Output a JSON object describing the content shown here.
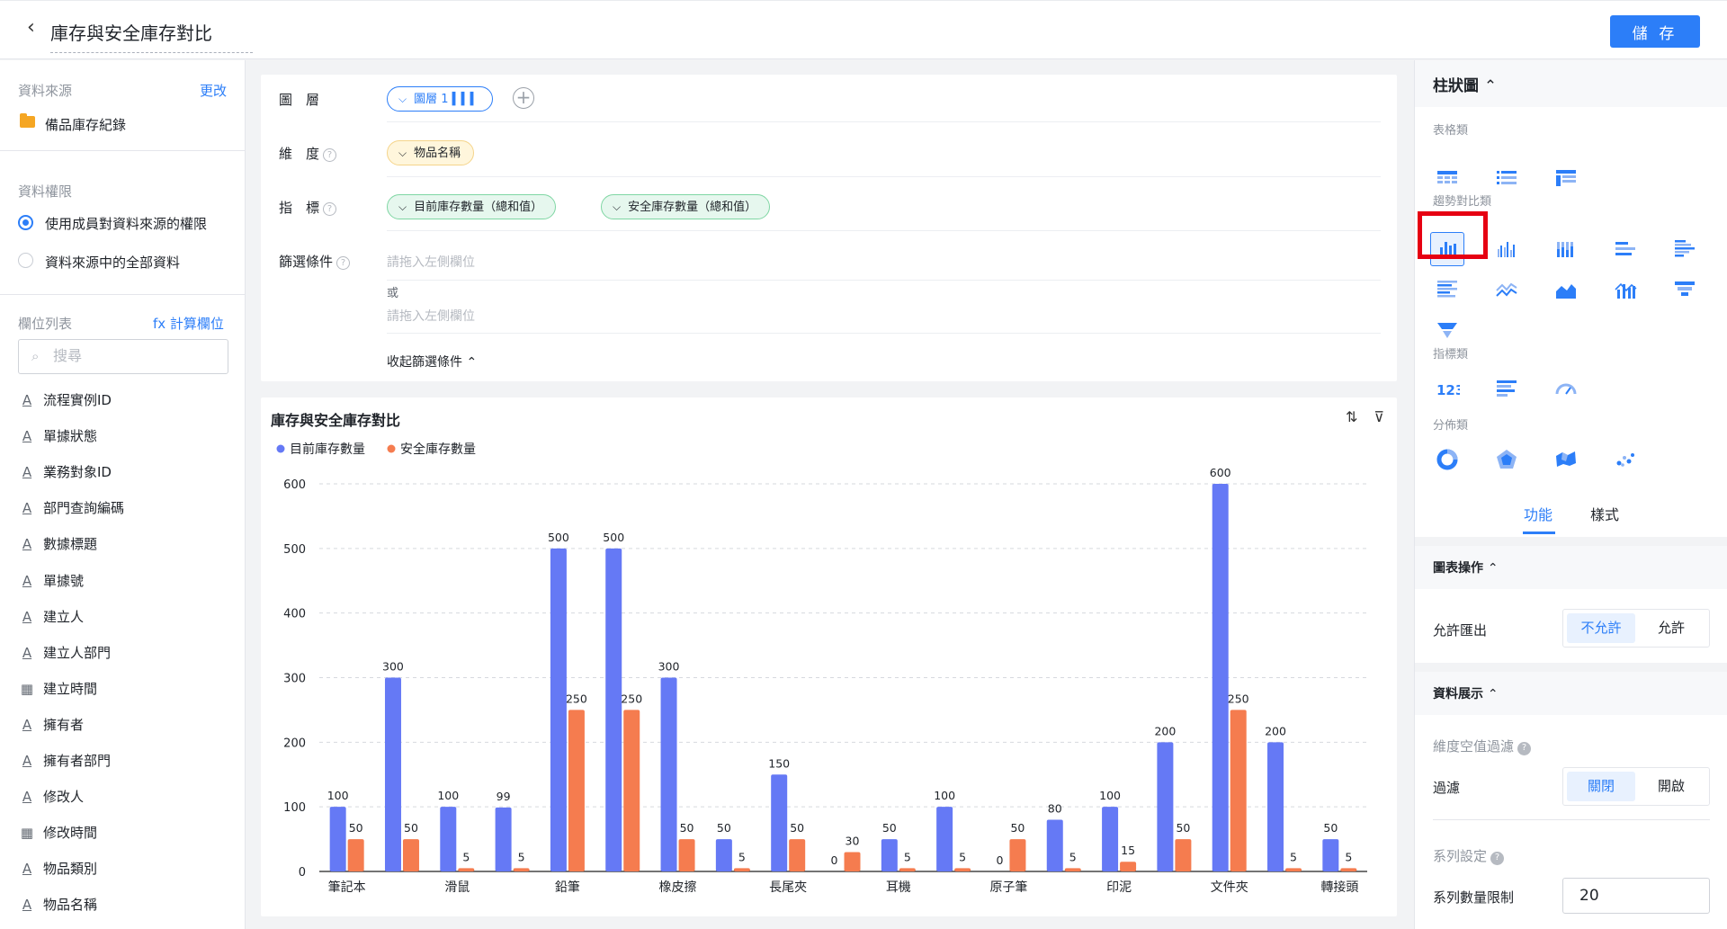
{
  "header": {
    "back_icon": "chevron-left-icon",
    "title": "庫存與安全庫存對比",
    "save_label": "儲 存"
  },
  "left": {
    "source_title": "資料來源",
    "change_label": "更改",
    "source_name": "備品庫存紀錄",
    "permission_title": "資料權限",
    "permission_options": [
      "使用成員對資料來源的權限",
      "資料來源中的全部資料"
    ],
    "fields_title": "欄位列表",
    "calc_label": "fx 計算欄位",
    "search_placeholder": "搜尋",
    "fields": [
      {
        "icon": "A",
        "label": "流程實例ID"
      },
      {
        "icon": "A",
        "label": "單據狀態"
      },
      {
        "icon": "A",
        "label": "業務對象ID"
      },
      {
        "icon": "A",
        "label": "部門查詢編碼"
      },
      {
        "icon": "A",
        "label": "數據標題"
      },
      {
        "icon": "A",
        "label": "單據號"
      },
      {
        "icon": "A",
        "label": "建立人"
      },
      {
        "icon": "A",
        "label": "建立人部門"
      },
      {
        "icon": "cal",
        "label": "建立時間"
      },
      {
        "icon": "A",
        "label": "擁有者"
      },
      {
        "icon": "A",
        "label": "擁有者部門"
      },
      {
        "icon": "A",
        "label": "修改人"
      },
      {
        "icon": "cal",
        "label": "修改時間"
      },
      {
        "icon": "A",
        "label": "物品類別"
      },
      {
        "icon": "A",
        "label": "物品名稱"
      }
    ]
  },
  "config": {
    "layer_label": "圖　層",
    "layer_pill": "圖層 1",
    "dimension_label": "維　度",
    "dimension_pill": "物品名稱",
    "metric_label": "指　標",
    "metric_pills": [
      "目前庫存數量（總和值）",
      "安全庫存數量（總和值）"
    ],
    "filter_label": "篩選條件",
    "filter_placeholder": "請拖入左側欄位",
    "or_label": "或",
    "filter_placeholder2": "請拖入左側欄位",
    "collapse_label": "收起篩選條件"
  },
  "chart_data": {
    "type": "bar",
    "title": "庫存與安全庫存對比",
    "categories": [
      "筆記本",
      "",
      "滑鼠",
      "",
      "鉛筆",
      "",
      "橡皮擦",
      "",
      "長尾夾",
      "",
      "耳機",
      "",
      "原子筆",
      "",
      "印泥",
      "",
      "文件夾",
      "",
      "轉接頭"
    ],
    "series": [
      {
        "name": "目前庫存數量",
        "color": "#6579f5",
        "values": [
          100,
          300,
          100,
          99,
          500,
          500,
          300,
          50,
          150,
          0,
          50,
          100,
          0,
          80,
          100,
          200,
          600,
          200,
          50
        ]
      },
      {
        "name": "安全庫存數量",
        "color": "#f57c4f",
        "values": [
          50,
          50,
          5,
          5,
          250,
          250,
          50,
          5,
          50,
          30,
          5,
          5,
          50,
          5,
          15,
          50,
          250,
          5,
          5
        ]
      }
    ],
    "ylim": [
      0,
      600
    ],
    "yticks": [
      "0",
      "100",
      "200",
      "300",
      "400",
      "500",
      "600"
    ],
    "grid": true,
    "legend": "top-left"
  },
  "right": {
    "chart_type_title": "柱狀圖",
    "cat_table": "表格類",
    "cat_trend": "趨勢對比類",
    "cat_indicator": "指標類",
    "cat_dist": "分佈類",
    "tab_function": "功能",
    "tab_style": "樣式",
    "section_ops": "圖表操作",
    "allow_export_label": "允許匯出",
    "export_options": [
      "不允許",
      "允許"
    ],
    "section_display": "資料展示",
    "dim_null_filter": "維度空值過濾",
    "filter_label": "過濾",
    "filter_options": [
      "關閉",
      "開啟"
    ],
    "series_settings": "系列設定",
    "series_limit_label": "系列數量限制",
    "series_limit_value": "20"
  }
}
